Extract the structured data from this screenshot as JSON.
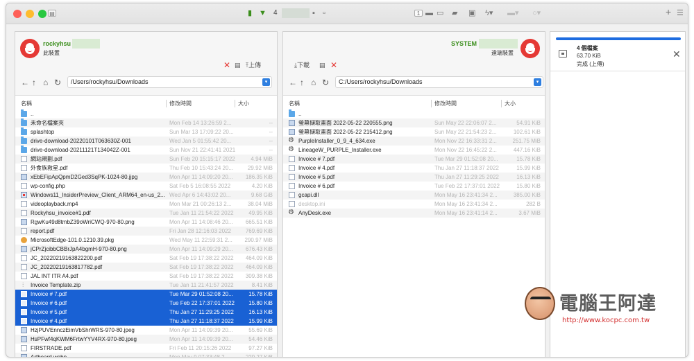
{
  "toolbar": {
    "count": "4"
  },
  "left": {
    "user": "rockyhsu",
    "sub": "此裝置",
    "actions": {
      "upload": "上傳"
    },
    "path": "/Users/rockyhsu/Downloads",
    "columns": {
      "name": "名稱",
      "time": "修改時間",
      "size": "大小"
    },
    "files": [
      {
        "name": "..",
        "time": "",
        "size": "",
        "icon": "folder"
      },
      {
        "name": "未命名檔案夾",
        "time": "Mon Feb 14 13:26:59 2...",
        "size": "--",
        "icon": "folder"
      },
      {
        "name": "splashtop",
        "time": "Sun Mar 13 17:09:22 20...",
        "size": "--",
        "icon": "folder"
      },
      {
        "name": "drive-download-20220101T063630Z-001",
        "time": "Wed Jan 5 01:55:42 20...",
        "size": "--",
        "icon": "folder"
      },
      {
        "name": "drive-download-20211121T134042Z-001",
        "time": "Sun Nov 21 22:41:41 2021",
        "size": "--",
        "icon": "folder"
      },
      {
        "name": "網站規劃.pdf",
        "time": "Sun Feb 20 15:15:17 2022",
        "size": "4.94 MiB",
        "icon": "file"
      },
      {
        "name": "外食族救星.pdf",
        "time": "Thu Feb 10 15:43:24 20...",
        "size": "29.92 MiB",
        "icon": "file"
      },
      {
        "name": "xEbEFipApQpmD2Ged3SqPK-1024-80.jjpg",
        "time": "Mon Apr 11 14:09:20 20...",
        "size": "186.35 KiB",
        "icon": "img"
      },
      {
        "name": "wp-config.php",
        "time": "Sat Feb 5 16:08:55 2022",
        "size": "4.20 KiB",
        "icon": "file"
      },
      {
        "name": "Windows11_InsiderPreview_Client_ARM64_en-us_2...",
        "time": "Wed Apr 6 14:43:02 20...",
        "size": "9.68 GiB",
        "icon": "win"
      },
      {
        "name": "videoplayback.mp4",
        "time": "Mon Mar 21 00:26:13 2...",
        "size": "38.04 MiB",
        "icon": "file"
      },
      {
        "name": "Rockyhsu_invoice#1.pdf",
        "time": "Tue Jan 11 21:54:22 2022",
        "size": "49.95 KiB",
        "icon": "file"
      },
      {
        "name": "RgwKu49d8tmbZ39oWriCWQ-970-80.png",
        "time": "Mon Apr 11 14:08:46 20...",
        "size": "665.51 KiB",
        "icon": "img"
      },
      {
        "name": "report.pdf",
        "time": "Fri Jan 28 12:16:03 2022",
        "size": "769.69 KiB",
        "icon": "file"
      },
      {
        "name": "MicrosoftEdge-101.0.1210.39.pkg",
        "time": "Wed May 11 22:59:31 2...",
        "size": "290.97 MiB",
        "icon": "pkg"
      },
      {
        "name": "jCPrZjcibbCBBrJpA4bgmH-970-80.png",
        "time": "Mon Apr 11 14:09:29 20...",
        "size": "676.43 KiB",
        "icon": "img"
      },
      {
        "name": "JC_20220219163822200.pdf",
        "time": "Sat Feb 19 17:38:22 2022",
        "size": "464.09 KiB",
        "icon": "file"
      },
      {
        "name": "JC_20220219163817782.pdf",
        "time": "Sat Feb 19 17:38:22 2022",
        "size": "464.09 KiB",
        "icon": "file"
      },
      {
        "name": "JAL INT ITR A4.pdf",
        "time": "Sat Feb 19 17:38:22 2022",
        "size": "309.38 KiB",
        "icon": "file"
      },
      {
        "name": "Invoice Template.zip",
        "time": "Tue Jan 11 21:41:57 2022",
        "size": "8.41 KiB",
        "icon": "zip"
      },
      {
        "name": "Invoice # 7.pdf",
        "time": "Tue Mar 29 01:52:08 20...",
        "size": "15.78 KiB",
        "icon": "file",
        "selected": true
      },
      {
        "name": "Invoice # 6.pdf",
        "time": "Tue Feb 22 17:37:01 2022",
        "size": "15.80 KiB",
        "icon": "file",
        "selected": true
      },
      {
        "name": "Invoice # 5.pdf",
        "time": "Thu Jan 27 11:29:25 2022",
        "size": "16.13 KiB",
        "icon": "file",
        "selected": true
      },
      {
        "name": "Invoice # 4.pdf",
        "time": "Thu Jan 27 11:18:37 2022",
        "size": "15.99 KiB",
        "icon": "file",
        "selected": true
      },
      {
        "name": "HzjPUVEnnczEimVbShrWRS-970-80.jpeg",
        "time": "Mon Apr 11 14:09:39 20...",
        "size": "55.69 KiB",
        "icon": "img"
      },
      {
        "name": "HsPFwf4qKWM6FrtwYYV4RX-970-80.jpeg",
        "time": "Mon Apr 11 14:09:39 20...",
        "size": "54.46 KiB",
        "icon": "img"
      },
      {
        "name": "FIRSTRADE.pdf",
        "time": "Fri Feb 11 20:15:26 2022",
        "size": "97.27 KiB",
        "icon": "file"
      },
      {
        "name": "Artboard.webp",
        "time": "Mon May 9 07:33:48 2...",
        "size": "229.27 KiB",
        "icon": "img"
      }
    ]
  },
  "right": {
    "user": "SYSTEM",
    "sub": "遠端裝置",
    "actions": {
      "download": "下載"
    },
    "path": "C:/Users/rockyhsu/Downloads",
    "columns": {
      "name": "名稱",
      "time": "修改時間",
      "size": "大小"
    },
    "files": [
      {
        "name": "..",
        "time": "",
        "size": "",
        "icon": "folder"
      },
      {
        "name": "螢幕擷取畫面 2022-05-22 220555.png",
        "time": "Sun May 22 22:06:07 2...",
        "size": "54.91 KiB",
        "icon": "img"
      },
      {
        "name": "螢幕擷取畫面 2022-05-22 215412.png",
        "time": "Sun May 22 21:54:23 2...",
        "size": "102.61 KiB",
        "icon": "img"
      },
      {
        "name": "PurpleInstaller_0_9_4_634.exe",
        "time": "Mon Nov 22 16:33:31 2...",
        "size": "251.75 MiB",
        "icon": "exe"
      },
      {
        "name": "LineageW_PURPLE_Installer.exe",
        "time": "Mon Nov 22 16:45:22 2...",
        "size": "447.16 KiB",
        "icon": "exe"
      },
      {
        "name": "Invoice # 7.pdf",
        "time": "Tue Mar 29 01:52:08 20...",
        "size": "15.78 KiB",
        "icon": "file"
      },
      {
        "name": "Invoice # 4.pdf",
        "time": "Thu Jan 27 11:18:37 2022",
        "size": "15.99 KiB",
        "icon": "file"
      },
      {
        "name": "Invoice # 5.pdf",
        "time": "Thu Jan 27 11:29:25 2022",
        "size": "16.13 KiB",
        "icon": "file"
      },
      {
        "name": "Invoice # 6.pdf",
        "time": "Tue Feb 22 17:37:01 2022",
        "size": "15.80 KiB",
        "icon": "file"
      },
      {
        "name": "gcapi.dll",
        "time": "Mon May 16 23:41:34 2...",
        "size": "385.00 KiB",
        "icon": "file"
      },
      {
        "name": "desktop.ini",
        "time": "Mon May 16 23:41:34 2...",
        "size": "282 B",
        "icon": "file",
        "dim": true
      },
      {
        "name": "AnyDesk.exe",
        "time": "Mon May 16 23:41:14 2...",
        "size": "3.67 MiB",
        "icon": "exe"
      }
    ]
  },
  "transfer": {
    "title": "4 個檔案",
    "size": "63.70 KiB",
    "status": "完成 (上傳)",
    "progress": 1.0
  },
  "watermark": {
    "title": "電腦王阿達",
    "url": "http://www.kocpc.com.tw"
  }
}
